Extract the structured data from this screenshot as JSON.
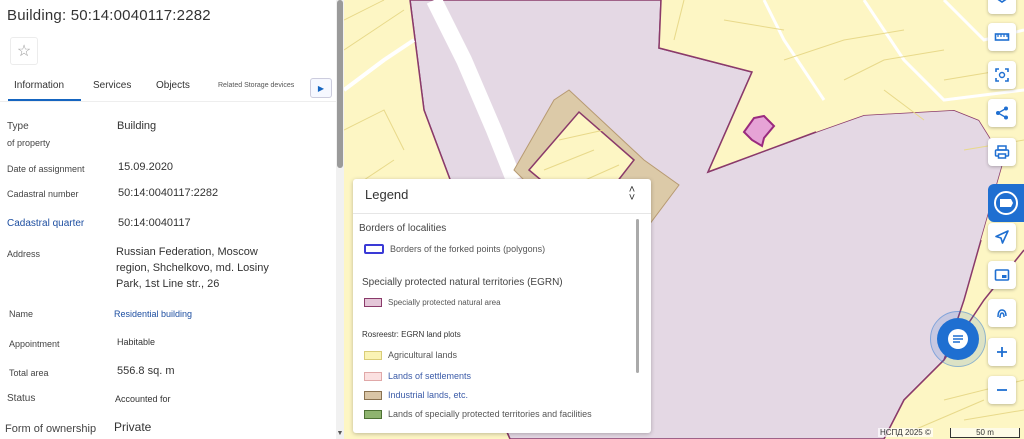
{
  "panel": {
    "title": "Building: 50:14:0040117:2282",
    "favorite_icon": "star-icon",
    "tabs": [
      {
        "label": "Information",
        "active": true
      },
      {
        "label": "Services"
      },
      {
        "label": "Objects"
      },
      {
        "label": "Related Storage devices"
      }
    ],
    "tabs_scroll_icon": "chevron-right-icon",
    "properties": {
      "type_label_1": "Type",
      "type_label_2": "of property",
      "type_value": "Building",
      "date_label": "Date of assignment",
      "date_value": "15.09.2020",
      "cad_number_label": "Cadastral number",
      "cad_number_value": "50:14:0040117:2282",
      "cad_quarter_label": "Cadastral quarter",
      "cad_quarter_value": "50:14:0040117",
      "address_label": "Address",
      "address_line1": "Russian Federation, Moscow",
      "address_line2": "region, Shchelkovo, md. Losiny",
      "address_line3": "Park, 1st Line str., 26",
      "name_label": "Name",
      "name_value": "Residential building",
      "appointment_label": "Appointment",
      "appointment_value": "Habitable",
      "area_label": "Total area",
      "area_value": "556.8 sq. m",
      "status_label": "Status",
      "status_value": "Accounted for",
      "ownership_label": "Form of ownership",
      "ownership_value": "Private"
    }
  },
  "legend": {
    "title": "Legend",
    "close_icon": "collapse-chevrons-icon",
    "groups": [
      {
        "heading": "Borders of localities",
        "items": [
          {
            "label": "Borders of the forked points (polygons)",
            "color": "#3a3ad6"
          }
        ]
      },
      {
        "heading": "Specially protected natural territories (EGRN)",
        "items": [
          {
            "label": "Specially protected natural area",
            "color": "#e4c6d8"
          }
        ]
      },
      {
        "heading": "Rosreestr: EGRN land plots",
        "items": [
          {
            "label": "Agricultural lands",
            "color": "#faf3b4"
          },
          {
            "label": "Lands of settlements",
            "color": "#fbe0e0"
          },
          {
            "label": "Industrial lands, etc.",
            "color": "#d9c5a6"
          },
          {
            "label": "Lands of specially protected territories and facilities",
            "color": "#8fb46f"
          }
        ]
      }
    ]
  },
  "toolbar": {
    "icons": [
      "layers-icon",
      "ruler-icon",
      "select-area-icon",
      "share-icon",
      "print-icon",
      "services-icon",
      "locate-icon",
      "picture-in-picture-icon",
      "fingerprint-icon",
      "zoom-in-icon",
      "zoom-out-icon"
    ],
    "chat_icon": "chat-icon"
  },
  "map": {
    "attribution": "НСПД 2025 ©",
    "scale_label": "50 m",
    "colors": {
      "agricultural": "#fdf6c4",
      "protected_area": "#e4d8e4",
      "protected_border": "#8a3a6a",
      "industrial": "#dccaa8",
      "road": "#ffffff",
      "building": "#e6a3d6"
    }
  }
}
